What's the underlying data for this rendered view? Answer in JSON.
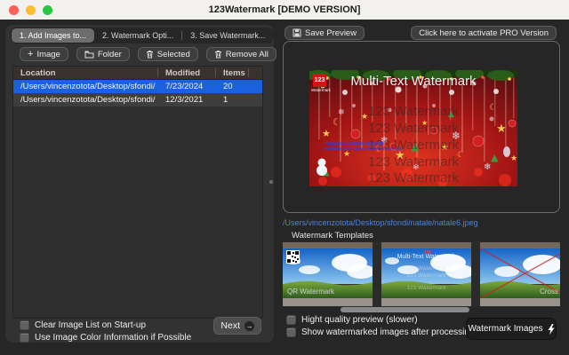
{
  "window": {
    "title": "123Watermark [DEMO VERSION]"
  },
  "tabs": [
    {
      "label": "1. Add Images to..."
    },
    {
      "label": "2. Watermark Opti..."
    },
    {
      "label": "3. Save Watermark..."
    }
  ],
  "toolbar": {
    "image": "Image",
    "folder": "Folder",
    "selected": "Selected",
    "remove_all": "Remove All"
  },
  "table": {
    "columns": [
      "Location",
      "Modified",
      "Items"
    ],
    "rows": [
      {
        "location": "/Users/vincenzotota/Desktop/sfondi/",
        "modified": "7/23/2024",
        "items": "20"
      },
      {
        "location": "/Users/vincenzotota/Desktop/sfondi/",
        "modified": "12/3/2021",
        "items": "1"
      }
    ]
  },
  "left_footer": {
    "clear_list": "Clear Image List on Start-up",
    "use_color": "Use Image Color Information if Possible",
    "next": "Next"
  },
  "right": {
    "save_preview": "Save Preview",
    "activate": "Click here to activate PRO Version",
    "path": "/Users/vincenzotota/Desktop/sfondi/natale/natale6.jpeg",
    "templates_title": "Watermark Templates",
    "hq_preview": "Hight quality preview (slower)",
    "show_after": "Show watermarked images after processing",
    "watermark_images": "Watermark Images"
  },
  "preview": {
    "logo": "123",
    "logo_sub": "Watermark",
    "wm_top": "Multi-Text Watermark",
    "wm_lines": [
      "123 Watermark",
      "123 Watermark",
      "123 Watermark",
      "123 Watermark",
      "123 Watermark"
    ],
    "demo_line1": "123Watermark DEMO VERSION",
    "demo_line2": "Purchase your copy at 123watermark.com"
  },
  "templates": [
    {
      "caption": "QR Watermark"
    },
    {
      "caption": "Multi-Text Watermark",
      "wm_top": "Multi-Text Watermark",
      "line1": "123 Watermark",
      "line2": "123 Watermark",
      "line3": "123 Watermark"
    },
    {
      "caption": "Cross Watermark"
    }
  ],
  "colors": {
    "selection_blue": "#1a62dd",
    "link_blue": "#4e82d9",
    "logo_red": "#d41414"
  }
}
